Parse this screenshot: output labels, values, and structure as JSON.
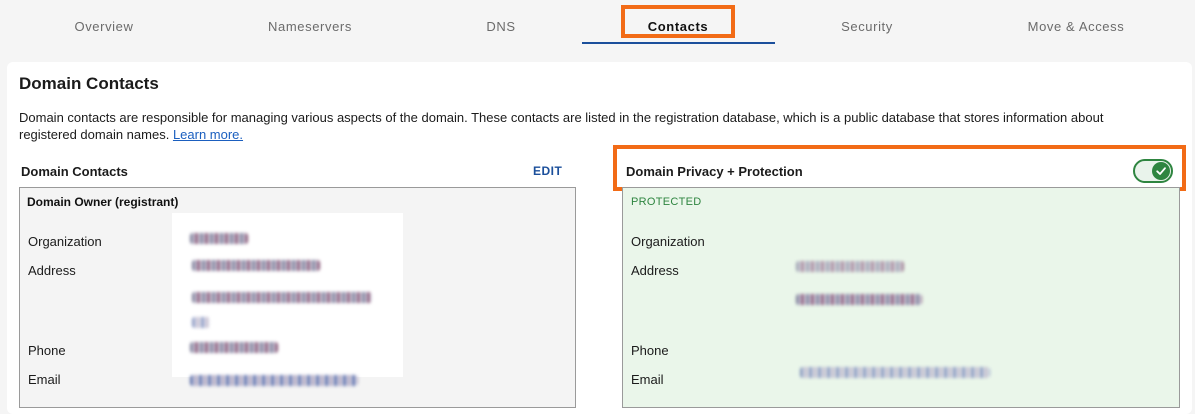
{
  "tabs": [
    {
      "label": "Overview"
    },
    {
      "label": "Nameservers"
    },
    {
      "label": "DNS"
    },
    {
      "label": "Contacts"
    },
    {
      "label": "Security"
    },
    {
      "label": "Move & Access"
    }
  ],
  "active_tab": "Contacts",
  "card": {
    "title": "Domain Contacts",
    "description": "Domain contacts are responsible for managing various aspects of the domain. These contacts are listed in the registration database, which is a public database that stores information about registered domain names.",
    "learn_more": "Learn more."
  },
  "contacts_section": {
    "heading": "Domain Contacts",
    "edit_label": "EDIT",
    "owner_title": "Domain Owner (registrant)",
    "fields": {
      "organization": "Organization",
      "address": "Address",
      "phone": "Phone",
      "email": "Email"
    }
  },
  "privacy": {
    "heading": "Domain Privacy + Protection",
    "toggle_on": true,
    "status": "PROTECTED",
    "fields": {
      "organization": "Organization",
      "address": "Address",
      "phone": "Phone",
      "email": "Email"
    }
  },
  "colors": {
    "highlight": "#f26b16",
    "accent": "#1b4f9b",
    "success": "#2e8540",
    "protected_bg": "#eaf6ea"
  },
  "icons": {
    "toggle": "check-icon"
  }
}
